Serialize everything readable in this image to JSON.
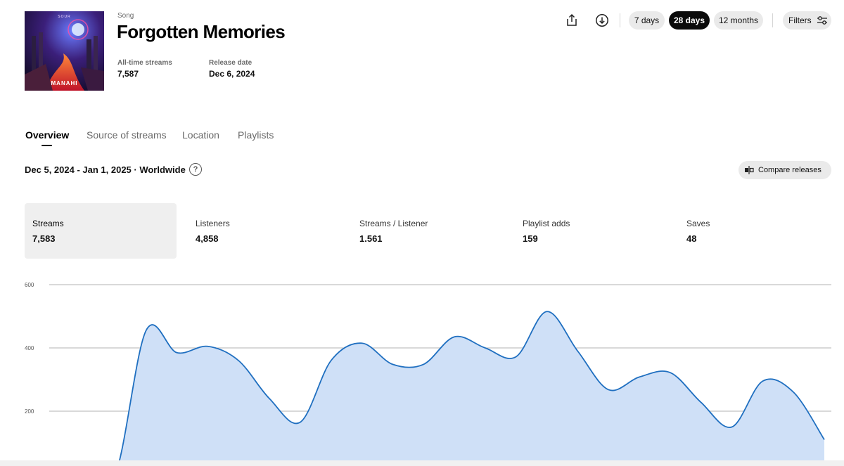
{
  "song": {
    "kind": "Song",
    "title": "Forgotten Memories",
    "cover": {
      "artist_logo": "MANAHI",
      "top_text": "SOUR",
      "accent_colors": [
        "#2a1b6e",
        "#e43a2a",
        "#ff7a2e",
        "#6cc6ff"
      ]
    },
    "meta": [
      {
        "label": "All-time streams",
        "value": "7,587"
      },
      {
        "label": "Release date",
        "value": "Dec 6, 2024"
      }
    ]
  },
  "toolbar": {
    "share_icon": "share-icon",
    "download_icon": "download-icon",
    "ranges": [
      {
        "label": "7 days",
        "active": false
      },
      {
        "label": "28 days",
        "active": true
      },
      {
        "label": "12 months",
        "active": false
      }
    ],
    "filters_label": "Filters",
    "filters_icon": "sliders-icon"
  },
  "tabs": [
    {
      "label": "Overview",
      "active": true
    },
    {
      "label": "Source of streams",
      "active": false
    },
    {
      "label": "Location",
      "active": false
    },
    {
      "label": "Playlists",
      "active": false
    }
  ],
  "range_text": "Dec 5, 2024 - Jan 1, 2025 · Worldwide",
  "help_icon": "question-circle-icon",
  "compare_label": "Compare releases",
  "metrics": [
    {
      "label": "Streams",
      "value": "7,583",
      "active": true
    },
    {
      "label": "Listeners",
      "value": "4,858",
      "active": false
    },
    {
      "label": "Streams / Listener",
      "value": "1.561",
      "active": false
    },
    {
      "label": "Playlist adds",
      "value": "159",
      "active": false
    },
    {
      "label": "Saves",
      "value": "48",
      "active": false
    }
  ],
  "colors": {
    "line": "#1f6fc0",
    "fill": "#cfe0f7",
    "active_pill": "#0b0b0b",
    "pill": "#eaeaea"
  },
  "chart_data": {
    "type": "area",
    "ylim": [
      0,
      600
    ],
    "yticks": [
      "600",
      "400",
      "200"
    ],
    "grid": true,
    "series": [
      {
        "values": [
          0,
          0,
          455,
          385,
          405,
          360,
          240,
          165,
          360,
          415,
          348,
          348,
          435,
          400,
          372,
          515,
          390,
          268,
          308,
          322,
          228,
          150,
          295,
          260,
          110
        ]
      }
    ]
  }
}
